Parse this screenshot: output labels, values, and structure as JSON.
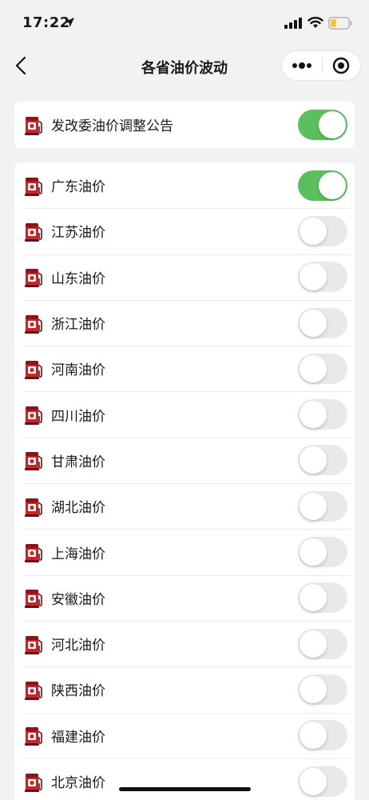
{
  "status_bar": {
    "time": "17:22",
    "icons": [
      "location-arrow-icon",
      "cellular-signal-icon",
      "wifi-icon",
      "battery-low-icon"
    ],
    "battery_color": "#f5c542"
  },
  "nav": {
    "title": "各省油价波动",
    "back_icon": "chevron-left-icon",
    "more_icon": "more-dots-icon",
    "close_icon": "miniprogram-close-icon"
  },
  "colors": {
    "toggle_on": "#5ac05e",
    "toggle_off": "#e9e9ea",
    "pump_red": "#c8242a",
    "background": "#f2f2f2"
  },
  "announcement": {
    "label": "发改委油价调整公告",
    "on": true,
    "icon": "fuel-pump-icon"
  },
  "provinces": [
    {
      "label": "广东油价",
      "on": true
    },
    {
      "label": "江苏油价",
      "on": false
    },
    {
      "label": "山东油价",
      "on": false
    },
    {
      "label": "浙江油价",
      "on": false
    },
    {
      "label": "河南油价",
      "on": false
    },
    {
      "label": "四川油价",
      "on": false
    },
    {
      "label": "甘肃油价",
      "on": false
    },
    {
      "label": "湖北油价",
      "on": false
    },
    {
      "label": "上海油价",
      "on": false
    },
    {
      "label": "安徽油价",
      "on": false
    },
    {
      "label": "河北油价",
      "on": false
    },
    {
      "label": "陕西油价",
      "on": false
    },
    {
      "label": "福建油价",
      "on": false
    },
    {
      "label": "北京油价",
      "on": false
    }
  ]
}
